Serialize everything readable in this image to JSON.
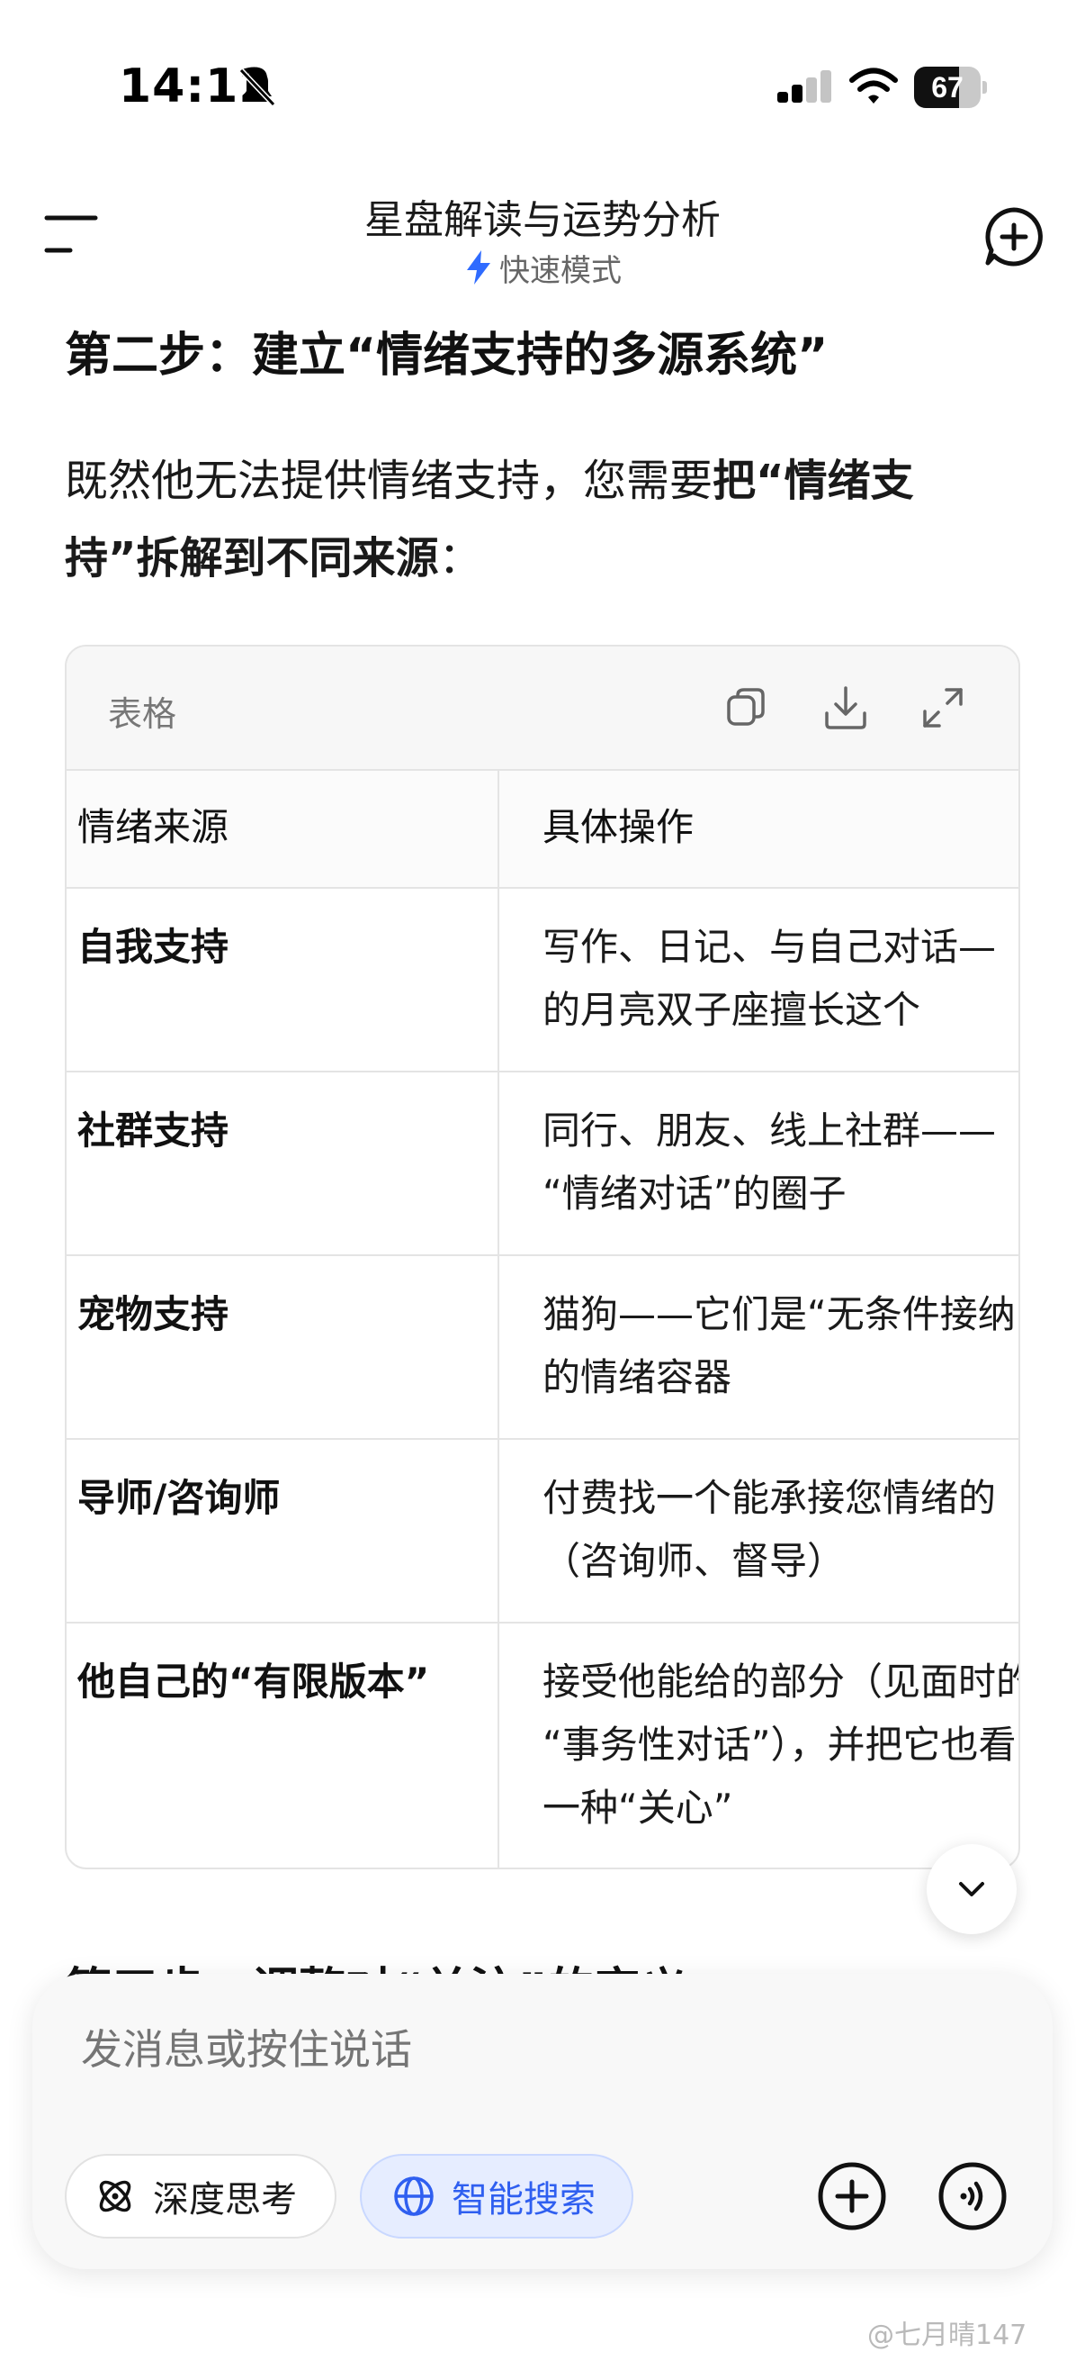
{
  "status_bar": {
    "time": "14:12",
    "battery_level": "67",
    "battery_fraction": 0.67,
    "icons": [
      "bell-slash-icon",
      "cellular-signal-icon",
      "wifi-icon",
      "battery-icon"
    ]
  },
  "header": {
    "title": "星盘解读与运势分析",
    "mode_label": "快速模式",
    "icons": [
      "menu-icon",
      "lightning-bolt-icon",
      "new-chat-icon"
    ],
    "accent_color": "#2f6bff"
  },
  "content": {
    "step2_heading": "第二步：建立“情绪支持的多源系统”",
    "intro": {
      "line1_plain": "既然他无法提供情绪支持，您需要",
      "line1_bold": "把“情绪支",
      "line2_bold": "持”拆解到不同来源",
      "line2_plain": "："
    },
    "table_card": {
      "label": "表格",
      "icons": [
        "copy-icon",
        "download-icon",
        "expand-icon"
      ],
      "headers": [
        "情绪来源",
        "具体操作"
      ],
      "rows": [
        {
          "source": "自我支持",
          "action": [
            "写作、日记、与自己对话—",
            "的月亮双子座擅长这个"
          ]
        },
        {
          "source": "社群支持",
          "action": [
            "同行、朋友、线上社群——",
            "“情绪对话”的圈子"
          ]
        },
        {
          "source": "宠物支持",
          "action": [
            "猫狗——它们是“无条件接纳",
            "的情绪容器"
          ]
        },
        {
          "source": "导师/咨询师",
          "action": [
            "付费找一个能承接您情绪的",
            "（咨询师、督导）"
          ]
        },
        {
          "source": "他自己的“有限版本”",
          "action": [
            "接受他能给的部分（见面时的",
            "“事务性对话”），并把它也看",
            "一种“关心”"
          ]
        }
      ]
    },
    "step3_heading_partial": "第三步：调整对“关注”的定义"
  },
  "composer": {
    "placeholder": "发消息或按住说话",
    "deep_think_label": "深度思考",
    "smart_search_label": "智能搜索",
    "icons": [
      "atom-icon",
      "globe-icon",
      "plus-circle-icon",
      "voice-call-icon"
    ],
    "smart_search_color": "#2f5ff0"
  },
  "watermark": "@七月晴147"
}
